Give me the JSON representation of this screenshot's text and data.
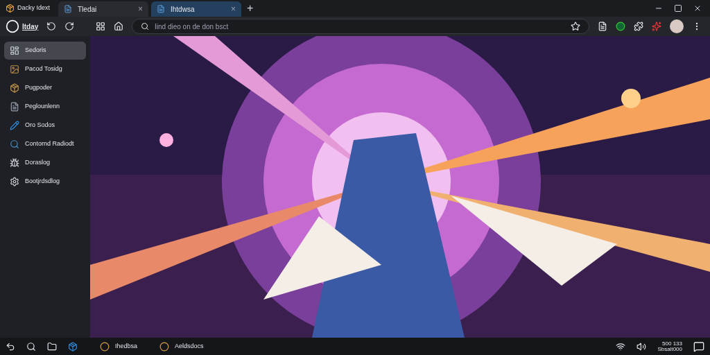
{
  "window": {
    "title": "Dacky Idext"
  },
  "tabs": [
    {
      "label": "Tledai",
      "selected": false,
      "close": "×"
    },
    {
      "label": "Ihtdwsa",
      "selected": true,
      "close": "×"
    }
  ],
  "new_tab": "+",
  "toolbar": {
    "logo_text": "Itday",
    "search": {
      "placeholder": "Iind dieo on de don bsct"
    }
  },
  "sidebar": {
    "items": [
      {
        "label": "Sedoris",
        "selected": true
      },
      {
        "label": "Pacod Tosidg",
        "selected": false
      },
      {
        "label": "Pugpoder",
        "selected": false
      },
      {
        "label": "Peglounlenn",
        "selected": false
      },
      {
        "label": "Oro Sodos",
        "selected": false
      },
      {
        "label": "Contornd Radiodt",
        "selected": false
      },
      {
        "label": "Doraslog",
        "selected": false
      },
      {
        "label": "Bootjrdsdlog",
        "selected": false
      }
    ]
  },
  "taskbar": {
    "apps": [
      {
        "label": "Ihedbsa"
      },
      {
        "label": "Aeldsdocs"
      }
    ],
    "clock": {
      "time": "500 133",
      "date": "Sbsalt000"
    }
  }
}
